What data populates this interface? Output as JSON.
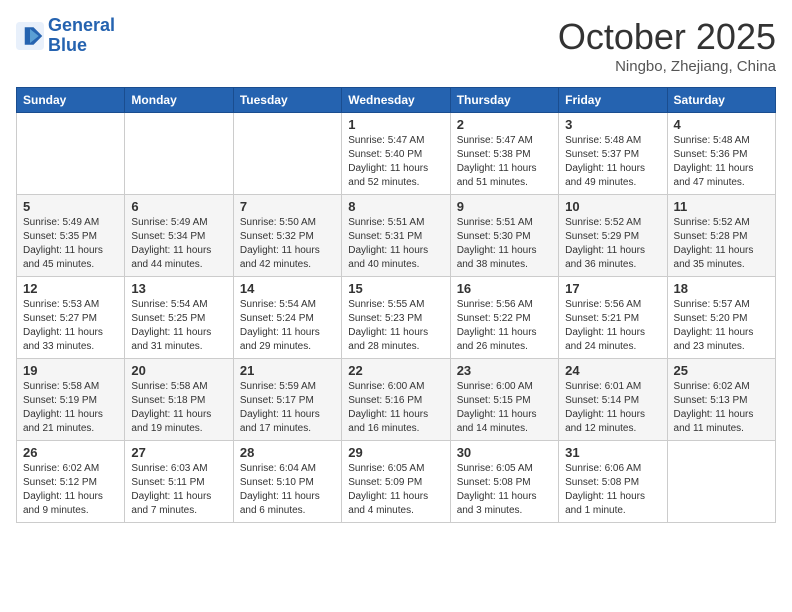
{
  "logo": {
    "line1": "General",
    "line2": "Blue"
  },
  "title": "October 2025",
  "location": "Ningbo, Zhejiang, China",
  "weekdays": [
    "Sunday",
    "Monday",
    "Tuesday",
    "Wednesday",
    "Thursday",
    "Friday",
    "Saturday"
  ],
  "weeks": [
    [
      {
        "day": "",
        "info": ""
      },
      {
        "day": "",
        "info": ""
      },
      {
        "day": "",
        "info": ""
      },
      {
        "day": "1",
        "info": "Sunrise: 5:47 AM\nSunset: 5:40 PM\nDaylight: 11 hours\nand 52 minutes."
      },
      {
        "day": "2",
        "info": "Sunrise: 5:47 AM\nSunset: 5:38 PM\nDaylight: 11 hours\nand 51 minutes."
      },
      {
        "day": "3",
        "info": "Sunrise: 5:48 AM\nSunset: 5:37 PM\nDaylight: 11 hours\nand 49 minutes."
      },
      {
        "day": "4",
        "info": "Sunrise: 5:48 AM\nSunset: 5:36 PM\nDaylight: 11 hours\nand 47 minutes."
      }
    ],
    [
      {
        "day": "5",
        "info": "Sunrise: 5:49 AM\nSunset: 5:35 PM\nDaylight: 11 hours\nand 45 minutes."
      },
      {
        "day": "6",
        "info": "Sunrise: 5:49 AM\nSunset: 5:34 PM\nDaylight: 11 hours\nand 44 minutes."
      },
      {
        "day": "7",
        "info": "Sunrise: 5:50 AM\nSunset: 5:32 PM\nDaylight: 11 hours\nand 42 minutes."
      },
      {
        "day": "8",
        "info": "Sunrise: 5:51 AM\nSunset: 5:31 PM\nDaylight: 11 hours\nand 40 minutes."
      },
      {
        "day": "9",
        "info": "Sunrise: 5:51 AM\nSunset: 5:30 PM\nDaylight: 11 hours\nand 38 minutes."
      },
      {
        "day": "10",
        "info": "Sunrise: 5:52 AM\nSunset: 5:29 PM\nDaylight: 11 hours\nand 36 minutes."
      },
      {
        "day": "11",
        "info": "Sunrise: 5:52 AM\nSunset: 5:28 PM\nDaylight: 11 hours\nand 35 minutes."
      }
    ],
    [
      {
        "day": "12",
        "info": "Sunrise: 5:53 AM\nSunset: 5:27 PM\nDaylight: 11 hours\nand 33 minutes."
      },
      {
        "day": "13",
        "info": "Sunrise: 5:54 AM\nSunset: 5:25 PM\nDaylight: 11 hours\nand 31 minutes."
      },
      {
        "day": "14",
        "info": "Sunrise: 5:54 AM\nSunset: 5:24 PM\nDaylight: 11 hours\nand 29 minutes."
      },
      {
        "day": "15",
        "info": "Sunrise: 5:55 AM\nSunset: 5:23 PM\nDaylight: 11 hours\nand 28 minutes."
      },
      {
        "day": "16",
        "info": "Sunrise: 5:56 AM\nSunset: 5:22 PM\nDaylight: 11 hours\nand 26 minutes."
      },
      {
        "day": "17",
        "info": "Sunrise: 5:56 AM\nSunset: 5:21 PM\nDaylight: 11 hours\nand 24 minutes."
      },
      {
        "day": "18",
        "info": "Sunrise: 5:57 AM\nSunset: 5:20 PM\nDaylight: 11 hours\nand 23 minutes."
      }
    ],
    [
      {
        "day": "19",
        "info": "Sunrise: 5:58 AM\nSunset: 5:19 PM\nDaylight: 11 hours\nand 21 minutes."
      },
      {
        "day": "20",
        "info": "Sunrise: 5:58 AM\nSunset: 5:18 PM\nDaylight: 11 hours\nand 19 minutes."
      },
      {
        "day": "21",
        "info": "Sunrise: 5:59 AM\nSunset: 5:17 PM\nDaylight: 11 hours\nand 17 minutes."
      },
      {
        "day": "22",
        "info": "Sunrise: 6:00 AM\nSunset: 5:16 PM\nDaylight: 11 hours\nand 16 minutes."
      },
      {
        "day": "23",
        "info": "Sunrise: 6:00 AM\nSunset: 5:15 PM\nDaylight: 11 hours\nand 14 minutes."
      },
      {
        "day": "24",
        "info": "Sunrise: 6:01 AM\nSunset: 5:14 PM\nDaylight: 11 hours\nand 12 minutes."
      },
      {
        "day": "25",
        "info": "Sunrise: 6:02 AM\nSunset: 5:13 PM\nDaylight: 11 hours\nand 11 minutes."
      }
    ],
    [
      {
        "day": "26",
        "info": "Sunrise: 6:02 AM\nSunset: 5:12 PM\nDaylight: 11 hours\nand 9 minutes."
      },
      {
        "day": "27",
        "info": "Sunrise: 6:03 AM\nSunset: 5:11 PM\nDaylight: 11 hours\nand 7 minutes."
      },
      {
        "day": "28",
        "info": "Sunrise: 6:04 AM\nSunset: 5:10 PM\nDaylight: 11 hours\nand 6 minutes."
      },
      {
        "day": "29",
        "info": "Sunrise: 6:05 AM\nSunset: 5:09 PM\nDaylight: 11 hours\nand 4 minutes."
      },
      {
        "day": "30",
        "info": "Sunrise: 6:05 AM\nSunset: 5:08 PM\nDaylight: 11 hours\nand 3 minutes."
      },
      {
        "day": "31",
        "info": "Sunrise: 6:06 AM\nSunset: 5:08 PM\nDaylight: 11 hours\nand 1 minute."
      },
      {
        "day": "",
        "info": ""
      }
    ]
  ]
}
